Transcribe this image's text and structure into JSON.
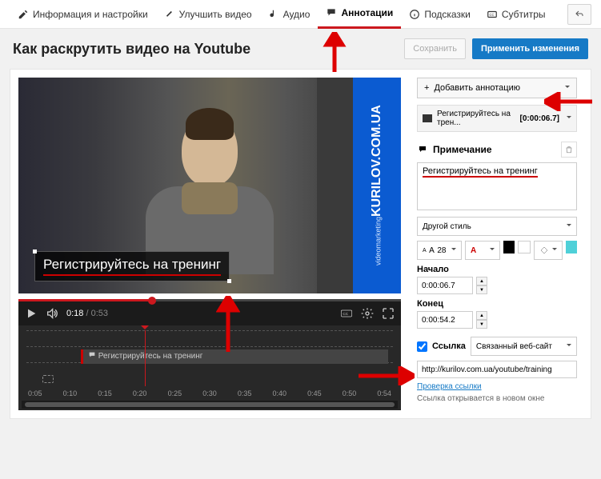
{
  "tabs": {
    "info": "Информация и настройки",
    "enhance": "Улучшить видео",
    "audio": "Аудио",
    "annotations": "Аннотации",
    "cards": "Подсказки",
    "subtitles": "Субтитры"
  },
  "title": "Как раскрутить видео на Youtube",
  "actions": {
    "save": "Сохранить",
    "apply": "Применить изменения"
  },
  "overlay": {
    "brand": "KURILOV.COM.UA",
    "brand_sub": "videomarketing"
  },
  "annotation_overlay_text": "Регистрируйтесь на тренинг",
  "player": {
    "current": "0:18",
    "duration": "0:53"
  },
  "timeline": {
    "item": "Регистрируйтесь на тренинг",
    "ticks": [
      "0:05",
      "0:10",
      "0:15",
      "0:20",
      "0:25",
      "0:30",
      "0:35",
      "0:40",
      "0:45",
      "0:50",
      "0:54"
    ]
  },
  "sidebar": {
    "add": "Добавить аннотацию",
    "item_title": "Регистрируйтесь на трен...",
    "item_time": "[0:00:06.7]",
    "note_header": "Примечание",
    "note_text": "Регистрируйтесь на тренинг",
    "style": "Другой стиль",
    "font_size": "28",
    "start_label": "Начало",
    "start": "0:00:06.7",
    "end_label": "Конец",
    "end": "0:00:54.2",
    "link_label": "Ссылка",
    "link_type": "Связанный веб-сайт",
    "link_url": "http://kurilov.com.ua/youtube/training",
    "link_check": "Проверка ссылки",
    "link_hint": "Ссылка открывается в новом окне"
  }
}
